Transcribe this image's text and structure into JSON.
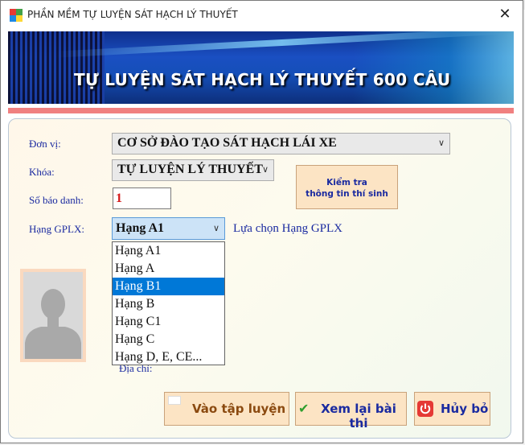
{
  "window": {
    "title": "PHẦN MỀM TỰ LUYỆN SÁT HẠCH LÝ THUYẾT",
    "close_label": "✕"
  },
  "banner": {
    "text": "TỰ LUYỆN SÁT HẠCH LÝ THUYẾT 600 CÂU"
  },
  "form": {
    "don_vi_label": "Đơn vị:",
    "don_vi_value": "CƠ SỞ ĐÀO TẠO SÁT HẠCH LÁI XE",
    "khoa_label": "Khóa:",
    "khoa_value": "TỰ LUYỆN LÝ THUYẾT",
    "so_bao_danh_label": "Số báo danh:",
    "so_bao_danh_value": "1",
    "check_button_line1": "Kiểm tra",
    "check_button_line2": "thông tin thí sinh",
    "hang_gplx_label": "Hạng GPLX:",
    "hang_gplx_value": "Hạng A1",
    "hang_gplx_hint": "Lựa chọn Hạng GPLX",
    "dia_chi_label": "Địa chỉ:"
  },
  "dropdown": {
    "options": [
      "Hạng A1",
      "Hạng A",
      "Hạng B1",
      "Hạng B",
      "Hạng C1",
      "Hạng C",
      "Hạng D, E, CE..."
    ],
    "highlighted": "Hạng B1"
  },
  "buttons": {
    "vao_tap_luyen": "Vào tập luyện",
    "xem_lai_bai_thi": "Xem lại bài thi",
    "huy_bo": "Hủy bỏ"
  },
  "colors": {
    "label_blue": "#1a2aa0",
    "selection_blue": "#0078d7",
    "accent_pink": "#f08080",
    "button_peach": "#fce4c4"
  },
  "icons": {
    "app": "app-icon",
    "close": "close-icon",
    "chevron": "chevron-down-icon",
    "check": "check-icon",
    "power": "power-icon",
    "avatar": "avatar-silhouette-icon"
  }
}
